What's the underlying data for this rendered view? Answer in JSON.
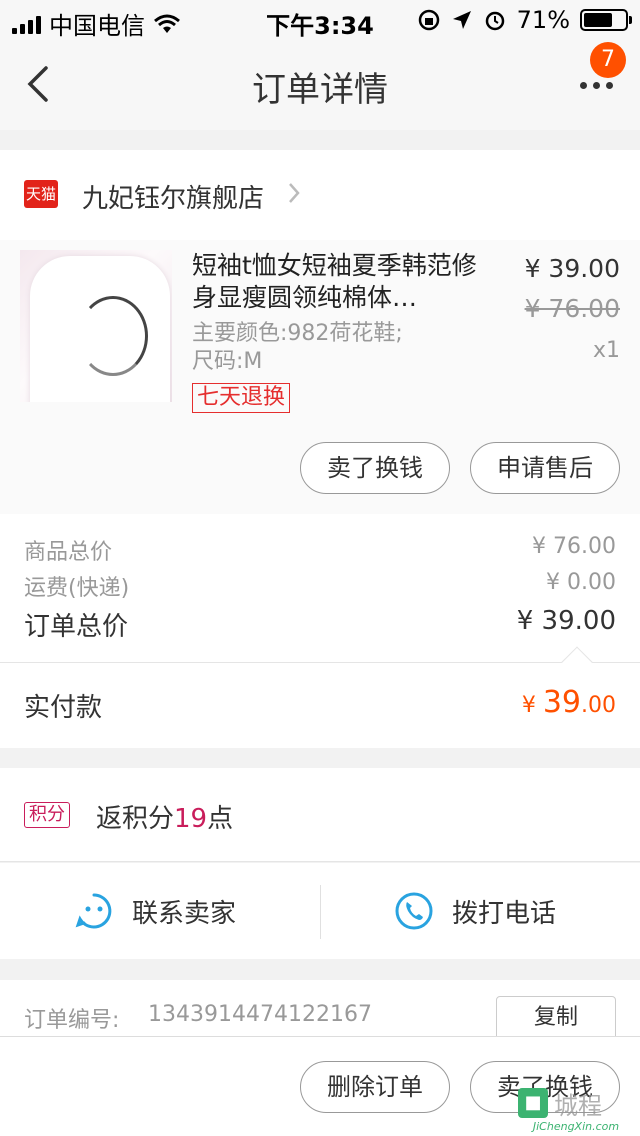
{
  "status_bar": {
    "carrier": "中国电信",
    "time": "下午3:34",
    "battery": "71%",
    "battery_level": 0.71
  },
  "nav": {
    "title": "订单详情",
    "badge_count": "7"
  },
  "shop": {
    "logo_text": "天猫",
    "name": "九妃钰尔旗舰店"
  },
  "product": {
    "title": "短袖t恤女短袖夏季韩范修身显瘦圆领纯棉体…",
    "spec_color": "主要颜色:982荷花鞋;",
    "spec_size": "尺码:M",
    "tag": "七天退换",
    "price": "¥ 39.00",
    "original_price": "¥ 76.00",
    "quantity": "x1",
    "btn_sell": "卖了换钱",
    "btn_aftersale": "申请售后"
  },
  "totals": {
    "goods_label": "商品总价",
    "goods_value": "¥ 76.00",
    "shipping_label": "运费(快递)",
    "shipping_value": "¥ 0.00",
    "order_label": "订单总价",
    "order_value": "¥ 39.00"
  },
  "paid": {
    "label": "实付款",
    "currency": "¥ ",
    "integer": "39",
    "decimal": ".00"
  },
  "points": {
    "tag": "积分",
    "prefix": "返积分",
    "value": "19",
    "suffix": "点"
  },
  "contact": {
    "seller": "联系卖家",
    "call": "拨打电话"
  },
  "order_no": {
    "label": "订单编号:",
    "value": "1343914474122167",
    "copy": "复制"
  },
  "bottom": {
    "delete": "删除订单",
    "sell": "卖了换钱"
  },
  "watermark": {
    "text": "城程",
    "url": "JiChengXin.com"
  },
  "colors": {
    "accent_orange": "#ff5000",
    "tmall_red": "#e2231a",
    "points_pink": "#c91d5b",
    "contact_blue": "#29a3e0"
  }
}
